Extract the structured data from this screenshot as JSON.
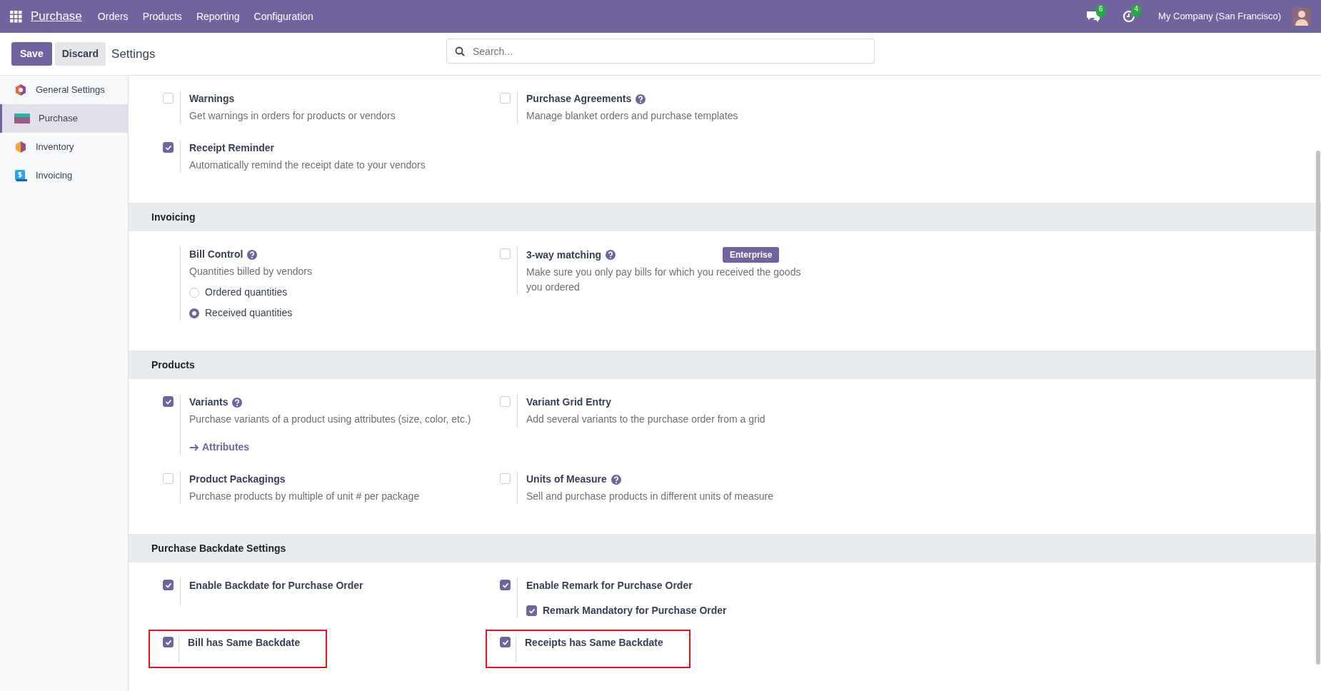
{
  "navbar": {
    "app": "Purchase",
    "menus": [
      "Orders",
      "Products",
      "Reporting",
      "Configuration"
    ],
    "messages_count": "6",
    "activities_count": "4",
    "company": "My Company (San Francisco)"
  },
  "control_panel": {
    "buttons": [
      {
        "label": "Save",
        "kind": "primary"
      },
      {
        "label": "Discard",
        "kind": "secondary"
      }
    ],
    "title": "Settings",
    "search": {
      "placeholder": "Search..."
    }
  },
  "sidebar": {
    "items": [
      {
        "label": "General Settings",
        "selected": false
      },
      {
        "label": "Purchase",
        "selected": true
      },
      {
        "label": "Inventory",
        "selected": false
      },
      {
        "label": "Invoicing",
        "selected": false
      }
    ]
  },
  "sections": [
    {
      "settings": [
        {
          "kind": "checkbox",
          "label": "Warnings",
          "description": "Get warnings in orders for products or vendors",
          "checked": false
        },
        {
          "kind": "checkbox",
          "label": "Purchase Agreements",
          "help": true,
          "description": "Manage blanket orders and purchase templates",
          "checked": false
        },
        {
          "kind": "checkbox",
          "label": "Receipt Reminder",
          "description": "Automatically remind the receipt date to your vendors",
          "checked": true
        }
      ]
    },
    {
      "title": "Invoicing",
      "settings": [
        {
          "kind": "radio",
          "label": "Bill Control",
          "help": true,
          "description": "Quantities billed by vendors",
          "options": [
            {
              "label": "Ordered quantities",
              "selected": false
            },
            {
              "label": "Received quantities",
              "selected": true
            }
          ]
        },
        {
          "kind": "checkbox",
          "label": "3-way matching",
          "help": true,
          "badge": "Enterprise",
          "description": "Make sure you only pay bills for which you received the goods you ordered",
          "checked": false
        }
      ]
    },
    {
      "title": "Products",
      "settings": [
        {
          "kind": "checkbox",
          "label": "Variants",
          "help": true,
          "description": "Purchase variants of a product using attributes (size, color, etc.)",
          "link": "Attributes",
          "checked": true
        },
        {
          "kind": "checkbox",
          "label": "Variant Grid Entry",
          "description": "Add several variants to the purchase order from a grid",
          "checked": false
        },
        {
          "kind": "checkbox",
          "label": "Product Packagings",
          "description": "Purchase products by multiple of unit # per package",
          "checked": false
        },
        {
          "kind": "checkbox",
          "label": "Units of Measure",
          "help": true,
          "description": "Sell and purchase products in different units of measure",
          "checked": false
        }
      ]
    },
    {
      "title": "Purchase Backdate Settings",
      "settings": [
        {
          "kind": "checkbox",
          "label": "Enable Backdate for Purchase Order",
          "checked": true
        },
        {
          "kind": "checkbox",
          "label": "Enable Remark for Purchase Order",
          "checked": true,
          "sub": {
            "label": "Remark Mandatory for Purchase Order",
            "checked": true
          }
        },
        {
          "kind": "checkbox",
          "label": "Bill has Same Backdate",
          "checked": true,
          "highlighted": true
        },
        {
          "kind": "checkbox",
          "label": "Receipts has Same Backdate",
          "checked": true,
          "highlighted": true
        }
      ]
    }
  ]
}
